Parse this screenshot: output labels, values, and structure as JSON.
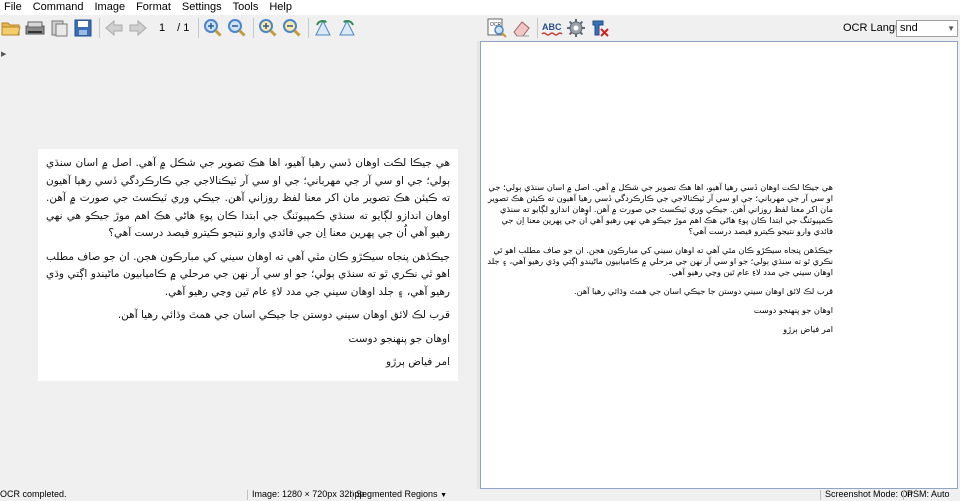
{
  "menu": [
    "File",
    "Command",
    "Image",
    "Format",
    "Settings",
    "Tools",
    "Help"
  ],
  "toolbar": {
    "page_current": "1",
    "page_total": "/ 1",
    "ocr_language_label": "OCR Language",
    "ocr_language_value": "snd"
  },
  "image_text": {
    "p1": "هي جيڪا لڪت اوهان ڏسي رهيا آهيو، اها هڪ تصوير جي شڪل ۾ آهي. اصل ۾ اسان سنڌي ٻولي؛ جي او سي آر جي مهرباني؛ جي او سي آر ٽيڪنالاجي جي ڪارڪردگي ڏسي رهيا آهيون ته ڪيئن هڪ تصوير مان اکر معنا لفظ روزاني آهن. جيڪي وري ٽيڪسٽ جي صورت ۾ آهن. اوهان اندازو لڳايو ته سنڌي ڪمپيوٽنگ جي ابتدا ڪان پوءِ هاڻي هڪ اهم موڙ جيڪو هي نهي رهيو آهي اُن جي پهرين معنا اِن جي فائدي وارو نتيجو ڪيترو فيصد درست آهي؟",
    "p2": "جيڪڏهن پنجاه سيڪڙو ڪان مٿي آهي ته اوهان سيني کي مبارڪون هجن. ان جو صاف مطلب اهو ٿي نڪري ٿو ته سنڌي ٻولي؛ جو او سي آر نهن جي مرحلي ۾ ڪاميابيون ماڻيندو اڳتي وڌي رهيو آهي، ۽ جلد اوهان سيني جي مدد لاءِ عام ٿين وڃي رهيو آهي.",
    "p3": "قرب لڪ لائق اوهان سيني دوستن جا جيڪي اسان جي همٿ وڌائي رهيا آهن.",
    "p4": "اوهان جو پنهنجو دوست",
    "p5": "امر فياض ٻرڙو"
  },
  "ocr_output": {
    "p1": "هي جيڪا لڪت اوهان ڏسي رهيا آهيو، اها هڪ تصوير جي شڪل ۾ آهي. اصل ۾ اسان سنڌي ٻولي؛ جي او سي آر جي مهرباني؛ جي او سي آر ٽيڪنالاجي جي ڪارڪردگي ڏسي رهيا آهيون ته ڪيئن هڪ تصوير مان اکر معنا لفظ روزاني آهن. جيڪي وري ٽيڪسٽ جي صورت ۾ آهن. اوهان اندازو لڳايو ته سنڌي ڪمپيوٽنگ جي ابتدا ڪان پوءِ هاڻي هڪ اهم موڙ جيڪو هي نهي رهيو آهي اُن جي پهرين معنا اِن جي فائدي وارو نتيجو ڪيترو فيصد درست آهي؟",
    "p2": "جيڪڏهن پنجاه سيڪڙو ڪان مٿي آهي ته اوهان سيني کي مبارڪون هجن. ان جو صاف مطلب اهو ٿي نڪري ٿو ته سنڌي ٻولي؛ جو او سي آر نهن جي مرحلي ۾ ڪاميابيون ماڻيندو اڳتي وڌي رهيو آهي، ۽ جلد اوهان سيني جي مدد لاءِ عام ٿين وڃي رهيو آهي.",
    "p3": "قرب لڪ لائق اوهان سيني دوستن جا جيڪي اسان جي همٿ وڌائي رهيا آهن.",
    "p4": "اوهان جو پنهنجو دوست",
    "p5": "امر فياض ٻرڙو"
  },
  "status": {
    "message": "OCR completed.",
    "image_info": "Image:  1280 × 720px  32bpp",
    "segmentation": "Segmented Regions",
    "screenshot_mode": "Screenshot Mode:  On",
    "psm": "PSM:  Auto"
  },
  "colors": {
    "folder": "#e8b64a",
    "blue_icon": "#3a6fb5",
    "magnifier": "#4a86c8",
    "abc_red": "#c0392b",
    "panel_border": "#8ea4c4"
  }
}
